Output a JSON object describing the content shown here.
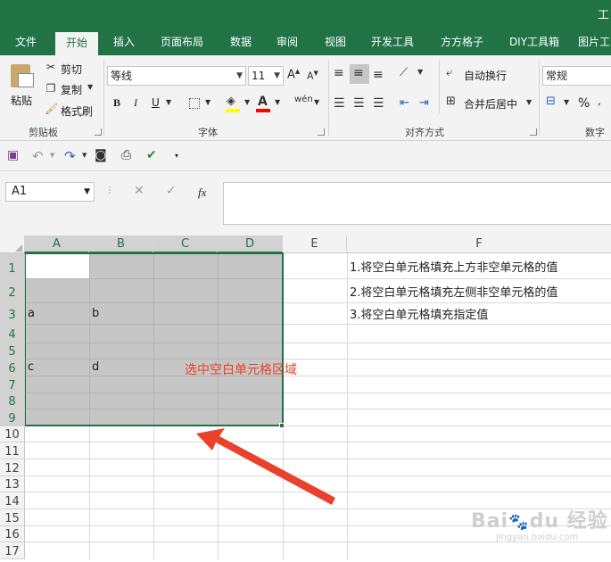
{
  "window": {
    "title": "工"
  },
  "tabs": [
    "文件",
    "开始",
    "插入",
    "页面布局",
    "数据",
    "审阅",
    "视图",
    "开发工具",
    "方方格子",
    "DIY工具箱",
    "图片工"
  ],
  "active_tab": "开始",
  "ribbon": {
    "clipboard": {
      "paste": "粘贴",
      "cut": "剪切",
      "copy": "复制",
      "format_painter": "格式刷",
      "label": "剪贴板"
    },
    "font": {
      "font_name": "等线",
      "font_size": "11",
      "bold": "B",
      "italic": "I",
      "underline": "U",
      "label": "字体",
      "font_color": "#ff0000",
      "fill_color": "#ffff00"
    },
    "alignment": {
      "wrap_text": "自动换行",
      "merge_center": "合并后居中",
      "label": "对齐方式"
    },
    "number": {
      "format": "常规",
      "percent": "%",
      "label": "数字"
    }
  },
  "formula_bar": {
    "name_box": "A1",
    "fx": "fx",
    "value": ""
  },
  "columns": [
    "A",
    "B",
    "C",
    "D",
    "E",
    "F"
  ],
  "rows": [
    "1",
    "2",
    "3",
    "4",
    "5",
    "6",
    "7",
    "8",
    "9",
    "10",
    "11",
    "12",
    "13",
    "14",
    "15",
    "16",
    "17"
  ],
  "cells": {
    "A3": "a",
    "B3": "b",
    "A6": "c",
    "B6": "d"
  },
  "notes": [
    "1.将空白单元格填充上方非空单元格的值",
    "2.将空白单元格填充左侧非空单元格的值",
    "3.将空白单元格填充指定值"
  ],
  "annotation": {
    "text": "选中空白单元格区域",
    "color": "#e8412c"
  },
  "selection": {
    "range": "A1:D9",
    "color": "#217346",
    "fill": "#c6c6c6"
  }
}
